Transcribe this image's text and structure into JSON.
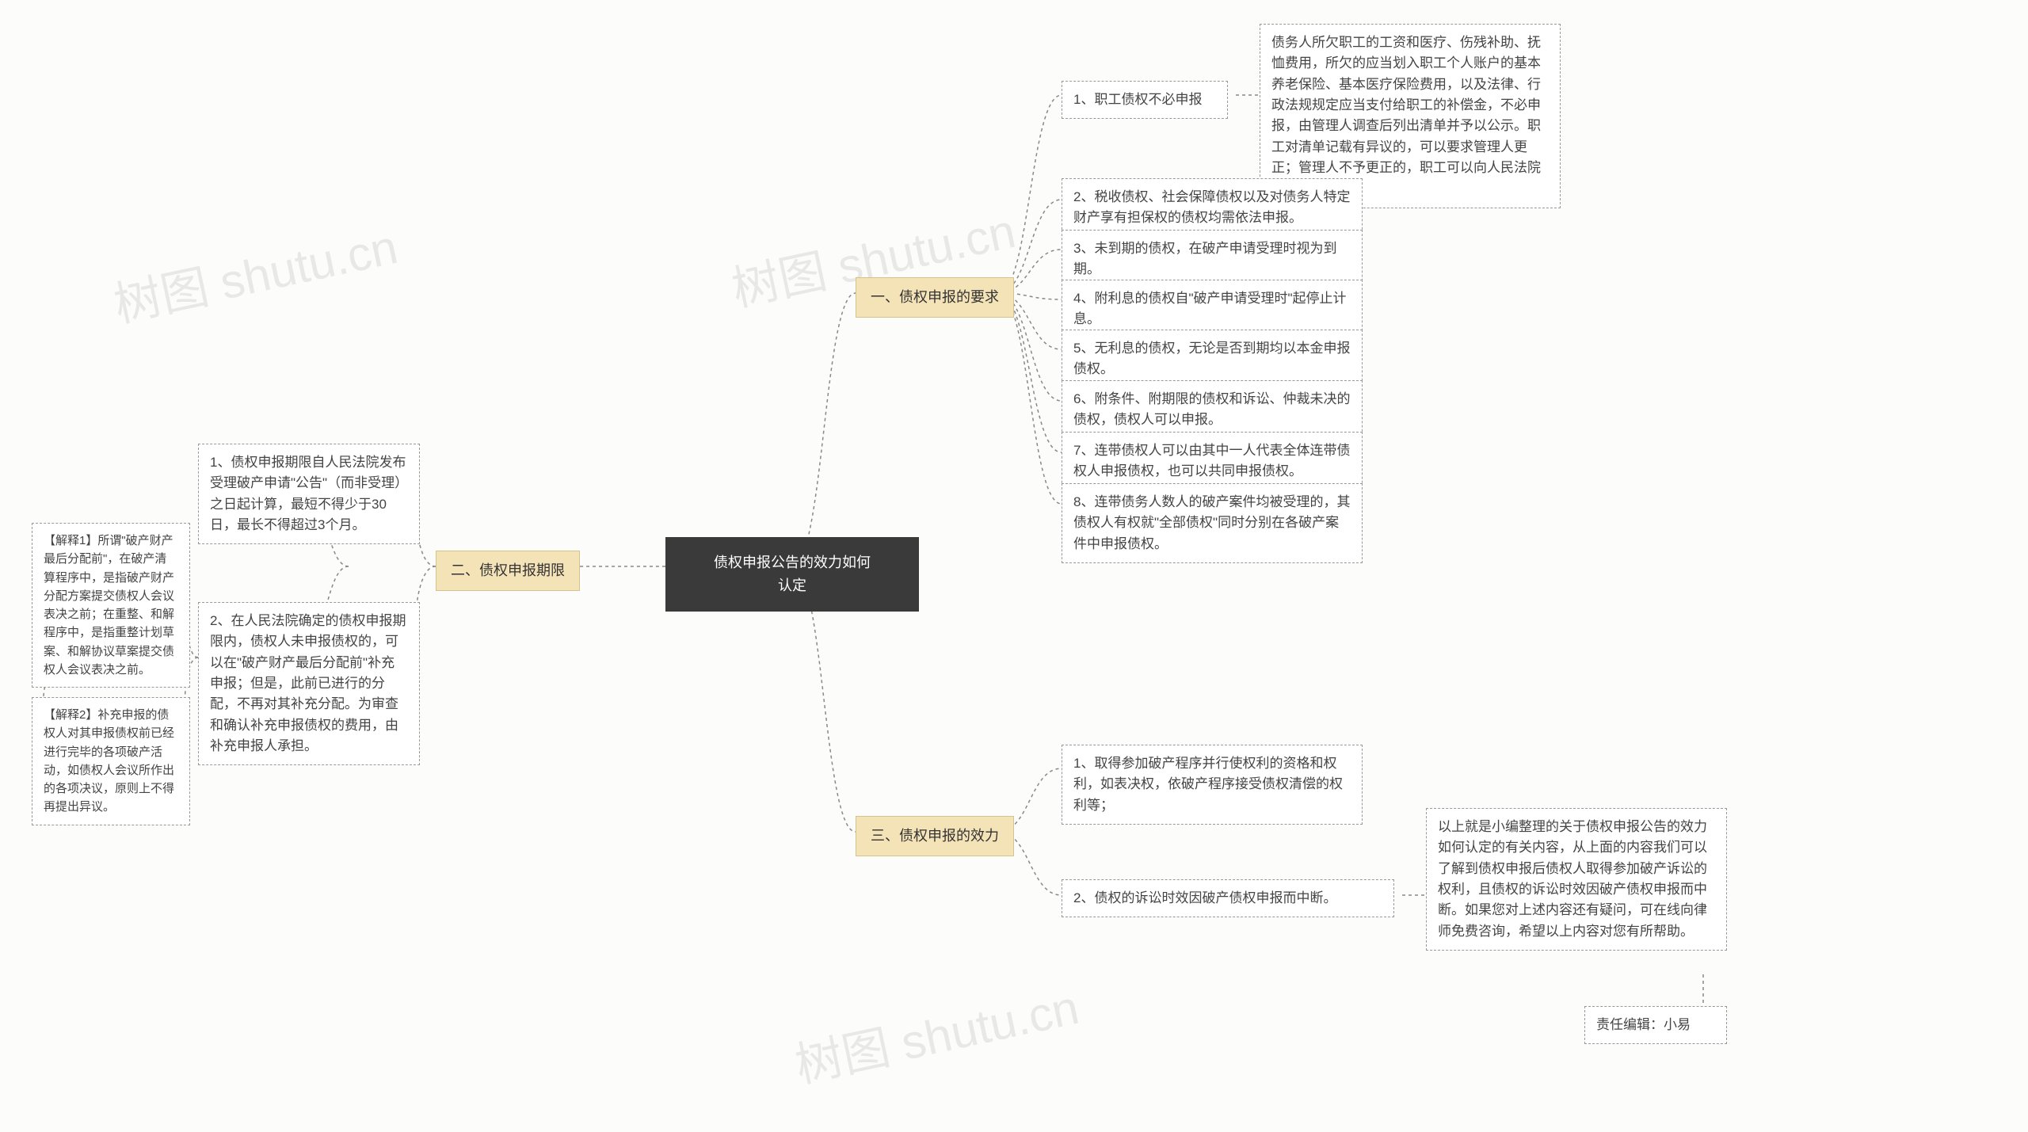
{
  "watermark": "树图 shutu.cn",
  "root": {
    "line1": "债权申报公告的效力如何",
    "line2": "认定"
  },
  "sections": {
    "s1": "一、债权申报的要求",
    "s2": "二、债权申报期限",
    "s3": "三、债权申报的效力"
  },
  "s1_items": {
    "i1": "1、职工债权不必申报",
    "i1_detail": "债务人所欠职工的工资和医疗、伤残补助、抚恤费用，所欠的应当划入职工个人账户的基本养老保险、基本医疗保险费用，以及法律、行政法规规定应当支付给职工的补偿金，不必申报，由管理人调查后列出清单并予以公示。职工对清单记载有异议的，可以要求管理人更正；管理人不予更正的，职工可以向人民法院提起诉讼。",
    "i2": "2、税收债权、社会保障债权以及对债务人特定财产享有担保权的债权均需依法申报。",
    "i3": "3、未到期的债权，在破产申请受理时视为到期。",
    "i4": "4、附利息的债权自\"破产申请受理时\"起停止计息。",
    "i5": "5、无利息的债权，无论是否到期均以本金申报债权。",
    "i6": "6、附条件、附期限的债权和诉讼、仲裁未决的债权，债权人可以申报。",
    "i7": "7、连带债权人可以由其中一人代表全体连带债权人申报债权，也可以共同申报债权。",
    "i8": "8、连带债务人数人的破产案件均被受理的，其债权人有权就\"全部债权\"同时分别在各破产案件中申报债权。"
  },
  "s2_items": {
    "i1": "1、债权申报期限自人民法院发布受理破产申请\"公告\"（而非受理）之日起计算，最短不得少于30日，最长不得超过3个月。",
    "i2": "2、在人民法院确定的债权申报期限内，债权人未申报债权的，可以在\"破产财产最后分配前\"补充申报；但是，此前已进行的分配，不再对其补充分配。为审查和确认补充申报债权的费用，由补充申报人承担。",
    "i2_exp1": "【解释1】所谓\"破产财产最后分配前\"，在破产清算程序中，是指破产财产分配方案提交债权人会议表决之前；在重整、和解程序中，是指重整计划草案、和解协议草案提交债权人会议表决之前。",
    "i2_exp2": "【解释2】补充申报的债权人对其申报债权前已经进行完毕的各项破产活动，如债权人会议所作出的各项决议，原则上不得再提出异议。"
  },
  "s3_items": {
    "i1": "1、取得参加破产程序并行使权利的资格和权利，如表决权，依破产程序接受债权清偿的权利等；",
    "i2": "2、债权的诉讼时效因破产债权申报而中断。",
    "i2_detail": "以上就是小编整理的关于债权申报公告的效力如何认定的有关内容，从上面的内容我们可以了解到债权申报后债权人取得参加破产诉讼的权利，且债权的诉讼时效因破产债权申报而中断。如果您对上述内容还有疑问，可在线向律师免费咨询，希望以上内容对您有所帮助。",
    "editor": "责任编辑：小易"
  }
}
